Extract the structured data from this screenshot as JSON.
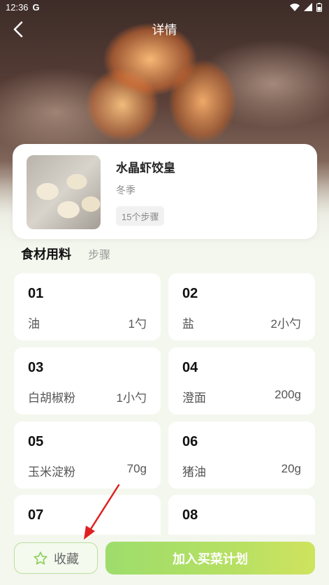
{
  "status_bar": {
    "time": "12:36",
    "app_icon": "G"
  },
  "nav": {
    "title": "详情"
  },
  "recipe": {
    "title": "水晶虾饺皇",
    "season": "冬季",
    "steps_badge": "15个步骤"
  },
  "tabs": [
    {
      "label": "食材用料",
      "active": true
    },
    {
      "label": "步骤",
      "active": false
    }
  ],
  "ingredients": [
    {
      "num": "01",
      "name": "油",
      "amount": "1勺"
    },
    {
      "num": "02",
      "name": "盐",
      "amount": "2小勺"
    },
    {
      "num": "03",
      "name": "白胡椒粉",
      "amount": "1小勺"
    },
    {
      "num": "04",
      "name": "澄面",
      "amount": "200g"
    },
    {
      "num": "05",
      "name": "玉米淀粉",
      "amount": "70g"
    },
    {
      "num": "06",
      "name": "猪油",
      "amount": "20g"
    },
    {
      "num": "07",
      "name": "",
      "amount": ""
    },
    {
      "num": "08",
      "name": "",
      "amount": ""
    }
  ],
  "bottom": {
    "favorite_label": "收藏",
    "plan_label": "加入买菜计划"
  },
  "colors": {
    "accent_green": "#a8de68",
    "page_bg": "#f4f7ee",
    "annotation_red": "#e02020"
  }
}
